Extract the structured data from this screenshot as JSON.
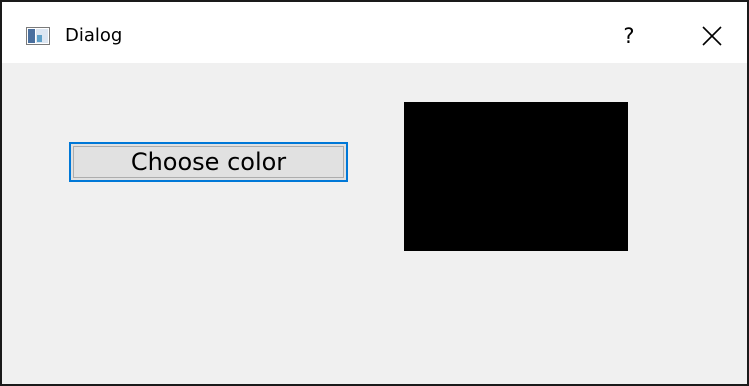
{
  "window": {
    "title": "Dialog",
    "app_icon": "qt-window-icon",
    "help_label": "?",
    "close_icon": "close-icon"
  },
  "dialog": {
    "choose_button_label": "Choose color",
    "selected_color": "#000000"
  },
  "colors": {
    "accent": "#0078d7",
    "button_face": "#e1e1e1",
    "dialog_background": "#f0f0f0",
    "titlebar_background": "#ffffff"
  }
}
